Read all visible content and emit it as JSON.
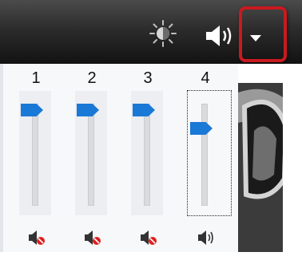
{
  "toolbar": {
    "icons": [
      "brightness-icon",
      "volume-icon",
      "dropdown-arrow-icon"
    ]
  },
  "mixer": {
    "channels": [
      {
        "number": "1",
        "level": 1.0,
        "muted": true
      },
      {
        "number": "2",
        "level": 1.0,
        "muted": true
      },
      {
        "number": "3",
        "level": 1.0,
        "muted": true
      },
      {
        "number": "4",
        "level": 0.82,
        "muted": false,
        "selected": true
      }
    ]
  },
  "colors": {
    "accent": "#1a78d6",
    "highlight": "#c81a1f",
    "mute": "#e02020"
  }
}
